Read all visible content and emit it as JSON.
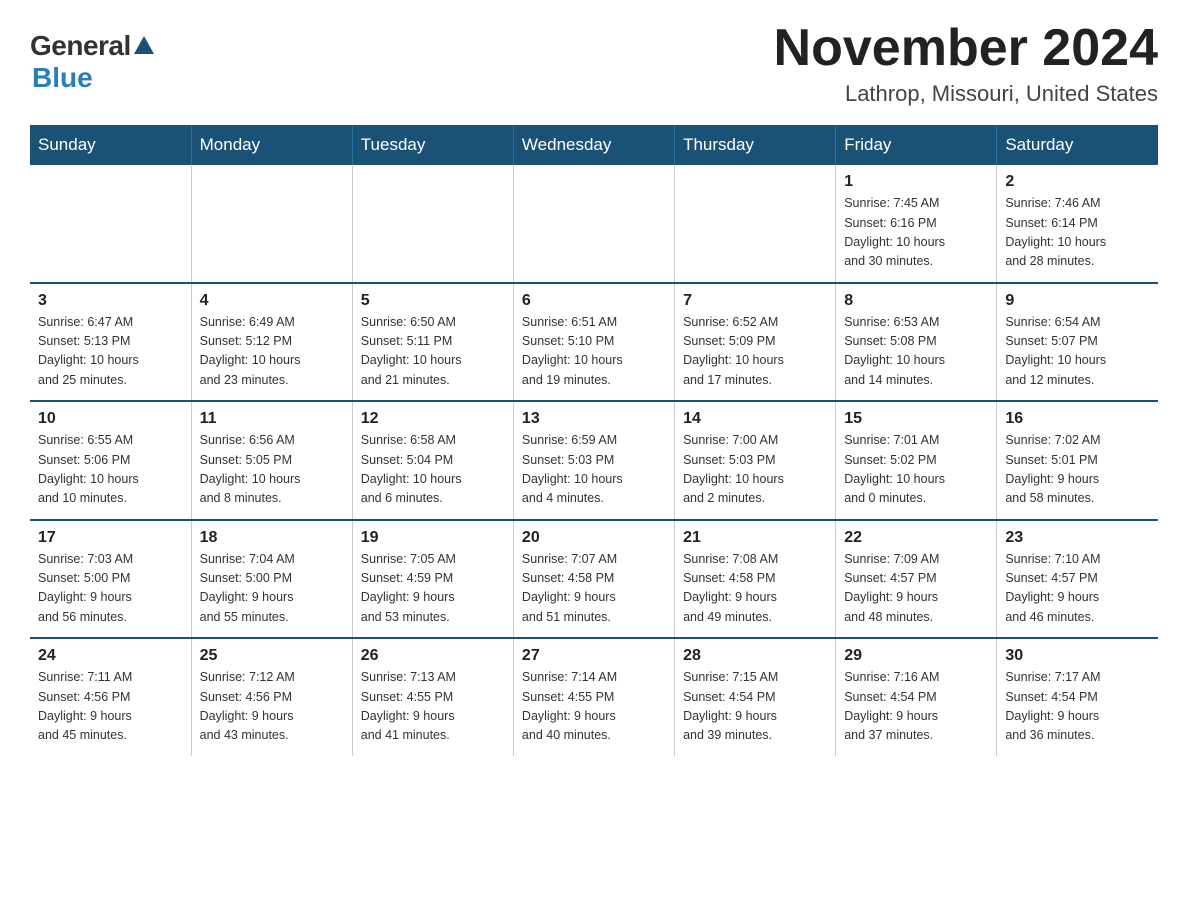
{
  "header": {
    "logo_general": "General",
    "logo_blue": "Blue",
    "month_title": "November 2024",
    "location": "Lathrop, Missouri, United States"
  },
  "days_of_week": [
    "Sunday",
    "Monday",
    "Tuesday",
    "Wednesday",
    "Thursday",
    "Friday",
    "Saturday"
  ],
  "weeks": [
    [
      {
        "day": "",
        "info": ""
      },
      {
        "day": "",
        "info": ""
      },
      {
        "day": "",
        "info": ""
      },
      {
        "day": "",
        "info": ""
      },
      {
        "day": "",
        "info": ""
      },
      {
        "day": "1",
        "info": "Sunrise: 7:45 AM\nSunset: 6:16 PM\nDaylight: 10 hours\nand 30 minutes."
      },
      {
        "day": "2",
        "info": "Sunrise: 7:46 AM\nSunset: 6:14 PM\nDaylight: 10 hours\nand 28 minutes."
      }
    ],
    [
      {
        "day": "3",
        "info": "Sunrise: 6:47 AM\nSunset: 5:13 PM\nDaylight: 10 hours\nand 25 minutes."
      },
      {
        "day": "4",
        "info": "Sunrise: 6:49 AM\nSunset: 5:12 PM\nDaylight: 10 hours\nand 23 minutes."
      },
      {
        "day": "5",
        "info": "Sunrise: 6:50 AM\nSunset: 5:11 PM\nDaylight: 10 hours\nand 21 minutes."
      },
      {
        "day": "6",
        "info": "Sunrise: 6:51 AM\nSunset: 5:10 PM\nDaylight: 10 hours\nand 19 minutes."
      },
      {
        "day": "7",
        "info": "Sunrise: 6:52 AM\nSunset: 5:09 PM\nDaylight: 10 hours\nand 17 minutes."
      },
      {
        "day": "8",
        "info": "Sunrise: 6:53 AM\nSunset: 5:08 PM\nDaylight: 10 hours\nand 14 minutes."
      },
      {
        "day": "9",
        "info": "Sunrise: 6:54 AM\nSunset: 5:07 PM\nDaylight: 10 hours\nand 12 minutes."
      }
    ],
    [
      {
        "day": "10",
        "info": "Sunrise: 6:55 AM\nSunset: 5:06 PM\nDaylight: 10 hours\nand 10 minutes."
      },
      {
        "day": "11",
        "info": "Sunrise: 6:56 AM\nSunset: 5:05 PM\nDaylight: 10 hours\nand 8 minutes."
      },
      {
        "day": "12",
        "info": "Sunrise: 6:58 AM\nSunset: 5:04 PM\nDaylight: 10 hours\nand 6 minutes."
      },
      {
        "day": "13",
        "info": "Sunrise: 6:59 AM\nSunset: 5:03 PM\nDaylight: 10 hours\nand 4 minutes."
      },
      {
        "day": "14",
        "info": "Sunrise: 7:00 AM\nSunset: 5:03 PM\nDaylight: 10 hours\nand 2 minutes."
      },
      {
        "day": "15",
        "info": "Sunrise: 7:01 AM\nSunset: 5:02 PM\nDaylight: 10 hours\nand 0 minutes."
      },
      {
        "day": "16",
        "info": "Sunrise: 7:02 AM\nSunset: 5:01 PM\nDaylight: 9 hours\nand 58 minutes."
      }
    ],
    [
      {
        "day": "17",
        "info": "Sunrise: 7:03 AM\nSunset: 5:00 PM\nDaylight: 9 hours\nand 56 minutes."
      },
      {
        "day": "18",
        "info": "Sunrise: 7:04 AM\nSunset: 5:00 PM\nDaylight: 9 hours\nand 55 minutes."
      },
      {
        "day": "19",
        "info": "Sunrise: 7:05 AM\nSunset: 4:59 PM\nDaylight: 9 hours\nand 53 minutes."
      },
      {
        "day": "20",
        "info": "Sunrise: 7:07 AM\nSunset: 4:58 PM\nDaylight: 9 hours\nand 51 minutes."
      },
      {
        "day": "21",
        "info": "Sunrise: 7:08 AM\nSunset: 4:58 PM\nDaylight: 9 hours\nand 49 minutes."
      },
      {
        "day": "22",
        "info": "Sunrise: 7:09 AM\nSunset: 4:57 PM\nDaylight: 9 hours\nand 48 minutes."
      },
      {
        "day": "23",
        "info": "Sunrise: 7:10 AM\nSunset: 4:57 PM\nDaylight: 9 hours\nand 46 minutes."
      }
    ],
    [
      {
        "day": "24",
        "info": "Sunrise: 7:11 AM\nSunset: 4:56 PM\nDaylight: 9 hours\nand 45 minutes."
      },
      {
        "day": "25",
        "info": "Sunrise: 7:12 AM\nSunset: 4:56 PM\nDaylight: 9 hours\nand 43 minutes."
      },
      {
        "day": "26",
        "info": "Sunrise: 7:13 AM\nSunset: 4:55 PM\nDaylight: 9 hours\nand 41 minutes."
      },
      {
        "day": "27",
        "info": "Sunrise: 7:14 AM\nSunset: 4:55 PM\nDaylight: 9 hours\nand 40 minutes."
      },
      {
        "day": "28",
        "info": "Sunrise: 7:15 AM\nSunset: 4:54 PM\nDaylight: 9 hours\nand 39 minutes."
      },
      {
        "day": "29",
        "info": "Sunrise: 7:16 AM\nSunset: 4:54 PM\nDaylight: 9 hours\nand 37 minutes."
      },
      {
        "day": "30",
        "info": "Sunrise: 7:17 AM\nSunset: 4:54 PM\nDaylight: 9 hours\nand 36 minutes."
      }
    ]
  ]
}
